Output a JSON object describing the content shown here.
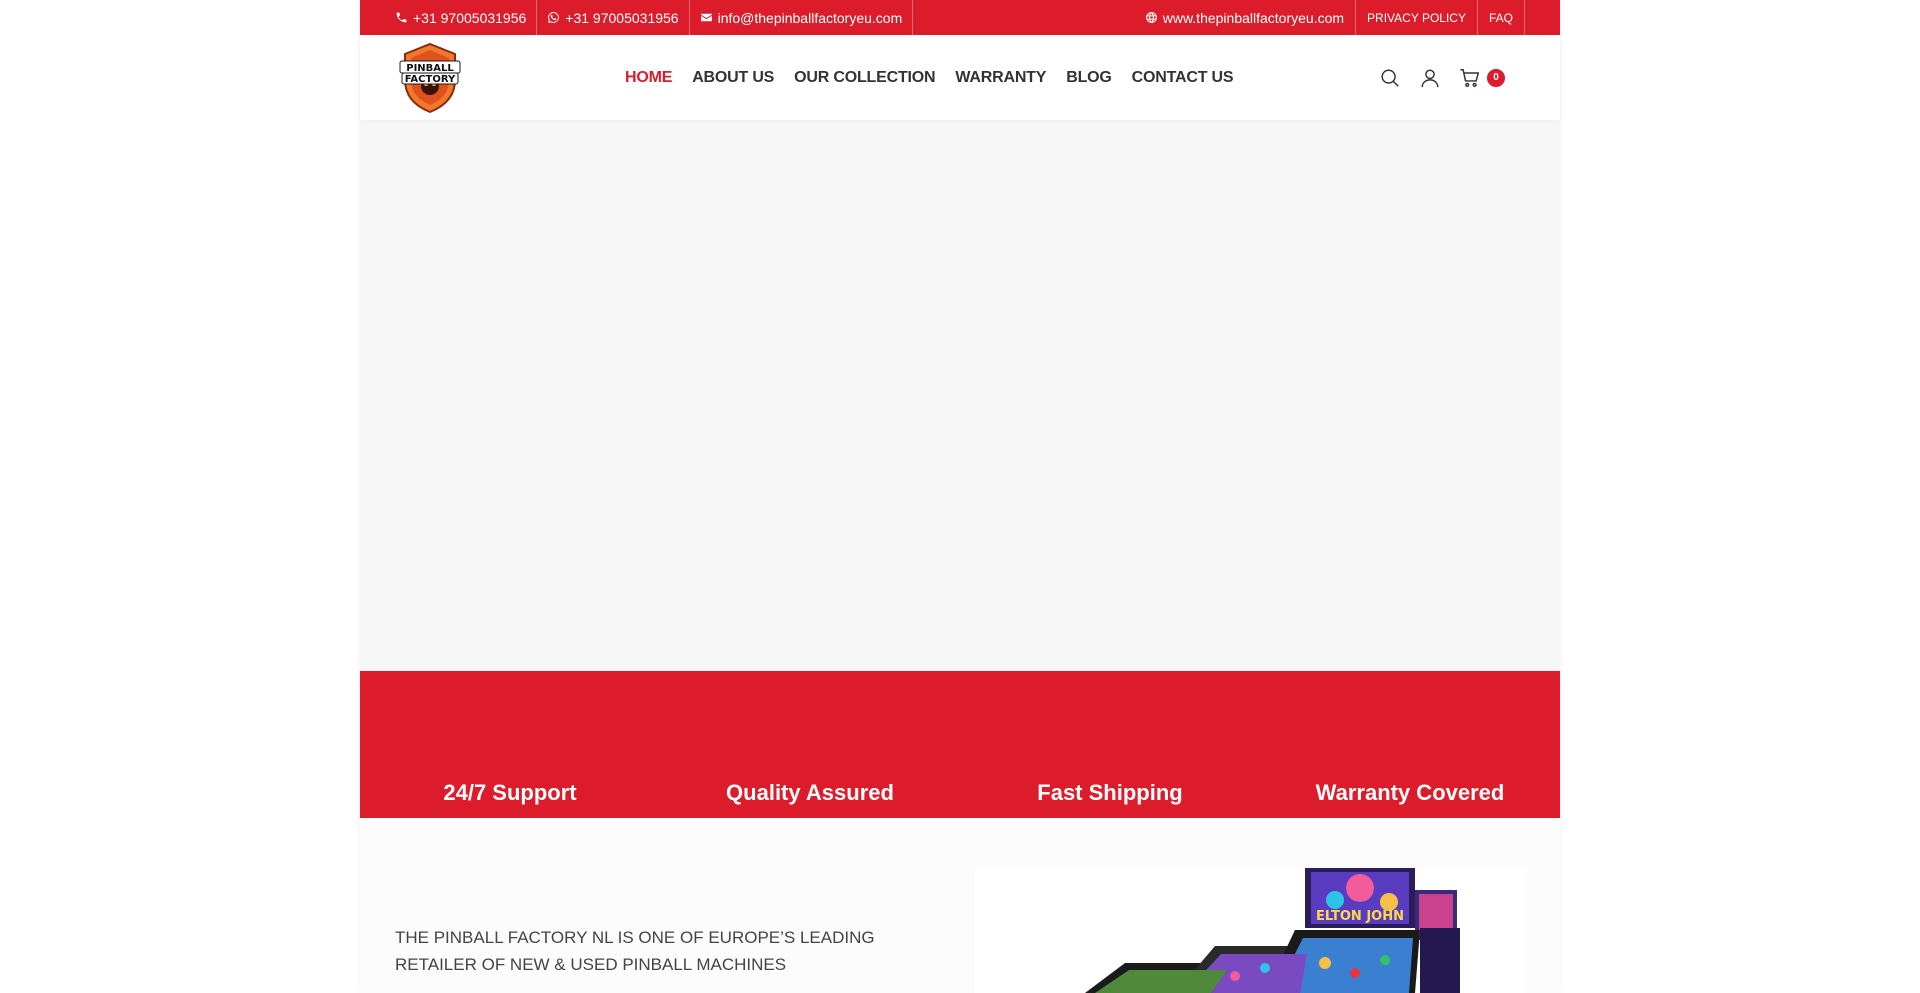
{
  "topbar": {
    "phone": "+31 97005031956",
    "whatsapp": "+31 97005031956",
    "email": "info@thepinballfactoryeu.com",
    "website": "www.thepinballfactoryeu.com",
    "privacy": "PRIVACY POLICY",
    "faq": "FAQ"
  },
  "brand": {
    "logo_line1": "PINBALL",
    "logo_line2": "FACTORY"
  },
  "nav": {
    "items": [
      {
        "label": "HOME",
        "active": true
      },
      {
        "label": "ABOUT US"
      },
      {
        "label": "OUR COLLECTION"
      },
      {
        "label": "WARRANTY"
      },
      {
        "label": "BLOG"
      },
      {
        "label": "CONTACT US"
      }
    ]
  },
  "header_tools": {
    "cart_count": "0"
  },
  "features": [
    {
      "label": "24/7 Support"
    },
    {
      "label": "Quality Assured"
    },
    {
      "label": "Fast Shipping"
    },
    {
      "label": "Warranty Covered"
    }
  ],
  "about": {
    "heading": "THE PINBALL FACTORY NL IS ONE OF EUROPE’S LEADING RETAILER OF NEW & USED PINBALL MACHINES",
    "image_text": "ELTON JOHN"
  },
  "colors": {
    "accent": "#dc1c2a",
    "hero_bg": "#f7f7f7"
  }
}
